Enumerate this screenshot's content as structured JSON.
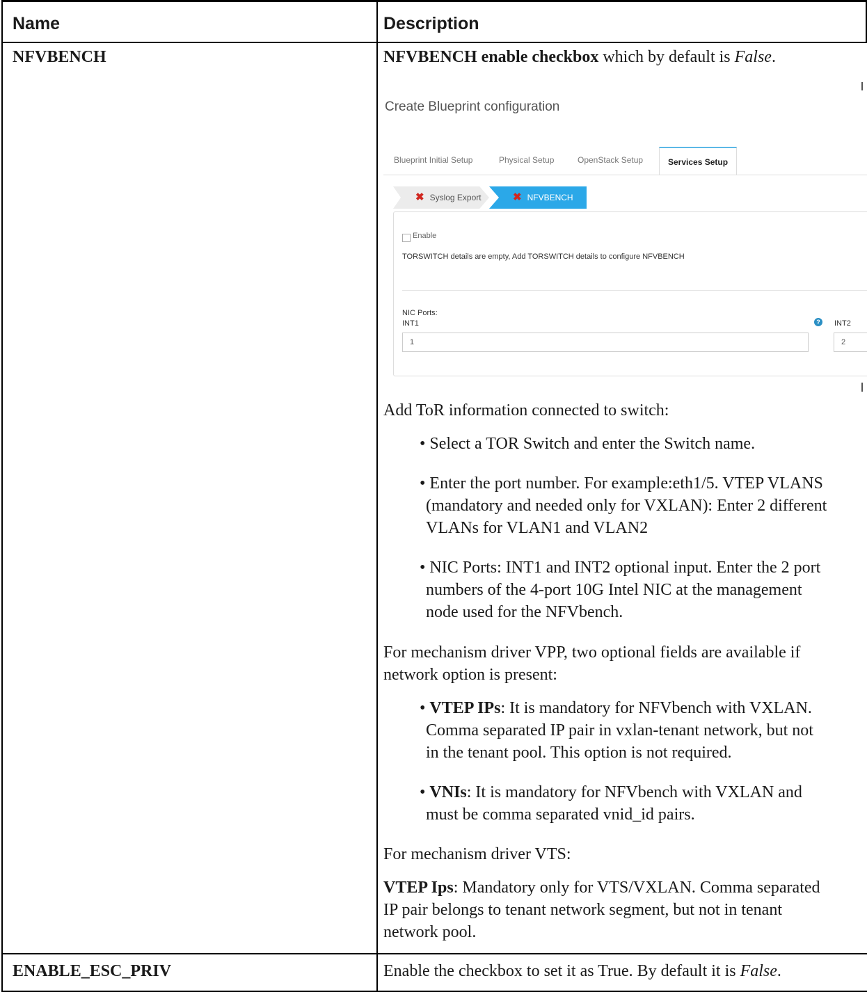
{
  "table": {
    "header": {
      "name": "Name",
      "description": "Description"
    },
    "rows": [
      {
        "name": "NFVBENCH",
        "desc_intro": {
          "bold": "NFVBENCH enable checkbox",
          "text": " which by default is ",
          "italic": "False",
          "end": "."
        },
        "screenshot": {
          "title": "Create Blueprint configuration",
          "tabs": [
            "Blueprint Initial Setup",
            "Physical Setup",
            "OpenStack Setup",
            "Services Setup"
          ],
          "active_tab": "Services Setup",
          "steps": [
            "Syslog Export",
            "NFVBENCH"
          ],
          "step_icon": "x-mark-icon",
          "enable_label": "Enable",
          "tor_message": "TORSWITCH details are empty, Add TORSWITCH details to configure NFVBENCH",
          "nic_ports_label": "NIC Ports:",
          "int1_label": "INT1",
          "int1_value": "1",
          "int2_label": "INT2",
          "int2_value": "2",
          "help_icon": "question-icon"
        },
        "tor_intro": "Add ToR information connected to switch:",
        "tor_bullets": [
          "• Select a TOR Switch and enter the Switch name.",
          "• Enter the port number. For example:eth1/5. VTEP VLANS",
          "(mandatory and needed only for VXLAN): Enter 2 different",
          "VLANs for VLAN1 and VLAN2",
          "• NIC Ports: INT1 and INT2 optional input. Enter the 2 port",
          "numbers of the 4-port 10G Intel NIC at the management",
          "node used for the NFVbench."
        ],
        "vpp_intro_1": "For mechanism driver VPP, two optional fields are available if",
        "vpp_intro_2": "network option is present:",
        "vtep_ips_term": "VTEP IPs",
        "vtep_ips_1": ": It is mandatory for NFVbench with VXLAN.",
        "vtep_ips_2": "Comma separated IP pair in vxlan-tenant network, but not",
        "vtep_ips_3": "in the tenant pool. This option is not required.",
        "vnis_term": "VNIs",
        "vnis_1": ": It is mandatory for NFVbench with VXLAN and",
        "vnis_2": "must be comma separated vnid_id pairs.",
        "vts_intro": "For mechanism driver VTS:",
        "vts_term": "VTEP Ips",
        "vts_1": ": Mandatory only for VTS/VXLAN. Comma separated",
        "vts_2": "IP pair belongs to tenant network segment, but not in tenant",
        "vts_3": "network pool."
      },
      {
        "name": "ENABLE_ESC_PRIV",
        "desc_text": "Enable the checkbox to set it as True. By default it is ",
        "desc_italic": "False",
        "desc_end": "."
      }
    ]
  }
}
